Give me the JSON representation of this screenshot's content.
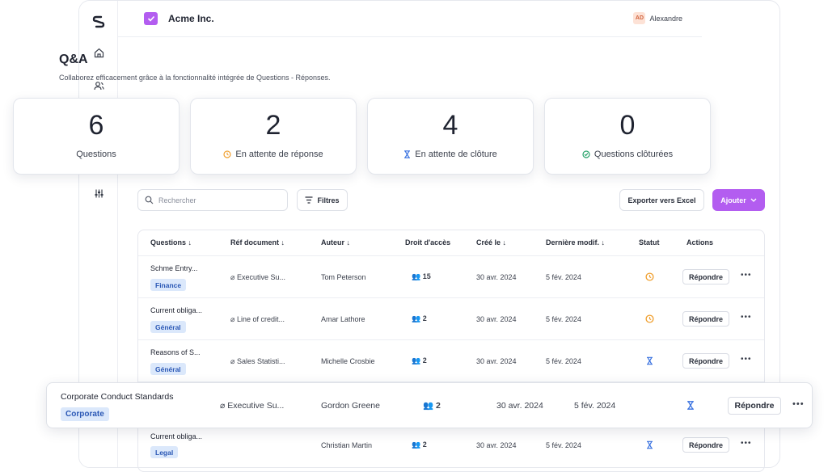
{
  "header": {
    "org": "Acme Inc.",
    "user_initials": "AD",
    "user_name": "Alexandre"
  },
  "page": {
    "title": "Q&A",
    "subtitle": "Collaborez efficacement grâce à la fonctionnalité intégrée de Questions - Réponses."
  },
  "stats": [
    {
      "value": "6",
      "label": "Questions"
    },
    {
      "value": "2",
      "label": "En attente de réponse"
    },
    {
      "value": "4",
      "label": "En attente de clôture"
    },
    {
      "value": "0",
      "label": "Questions clôturées"
    }
  ],
  "toolbar": {
    "search_placeholder": "Rechercher",
    "filters": "Filtres",
    "export": "Exporter vers Excel",
    "add": "Ajouter"
  },
  "columns": [
    "Questions",
    "Réf document",
    "Auteur",
    "Droit d'accès",
    "Créé le",
    "Dernière modif.",
    "Statut",
    "Actions"
  ],
  "rows": [
    {
      "question": "Schme Entry...",
      "tag": "Finance",
      "doc": "Executive Su...",
      "author": "Tom Peterson",
      "access": "15",
      "created": "30 avr. 2024",
      "modified": "5 fév. 2024",
      "status": "pending-answer",
      "action": "Répondre"
    },
    {
      "question": "Current obliga...",
      "tag": "Général",
      "doc": "Line of credit...",
      "author": "Amar Lathore",
      "access": "2",
      "created": "30 avr. 2024",
      "modified": "5 fév. 2024",
      "status": "pending-answer",
      "action": "Répondre"
    },
    {
      "question": "Reasons of S...",
      "tag": "Général",
      "doc": "Sales Statisti...",
      "author": "Michelle Crosbie",
      "access": "2",
      "created": "30 avr. 2024",
      "modified": "5 fév. 2024",
      "status": "pending-closure",
      "action": "Répondre"
    },
    {
      "question": "Corporate Conduct Standards",
      "tag": "Corporate",
      "doc": "Executive Su...",
      "author": "Gordon Greene",
      "access": "2",
      "created": "30 avr. 2024",
      "modified": "5 fév. 2024",
      "status": "pending-closure",
      "action": "Répondre"
    },
    {
      "question": "Current obliga...",
      "tag": "Legal",
      "doc": "",
      "author": "Christian Martin",
      "access": "2",
      "created": "30 avr. 2024",
      "modified": "5 fév. 2024",
      "status": "pending-closure",
      "action": "Répondre"
    }
  ],
  "colors": {
    "accent": "#b35df0",
    "pending_answer": "#f0a030",
    "pending_closure": "#3a72e0",
    "closed": "#27a36a",
    "tag_bg": "#dbe8fb"
  }
}
